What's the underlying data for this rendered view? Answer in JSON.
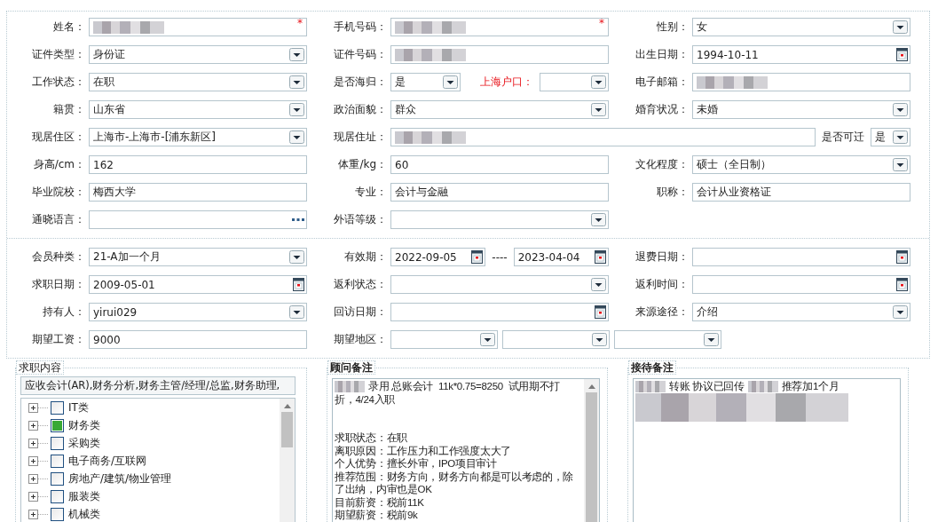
{
  "form_sections": [
    {
      "rows": [
        {
          "cells": [
            {
              "items": [
                {
                  "label": "姓名：",
                  "kind": "text",
                  "redacted": true,
                  "required_mark": "*"
                }
              ]
            },
            {
              "items": [
                {
                  "label": "手机号码：",
                  "kind": "text",
                  "redacted": true,
                  "required_mark": "*"
                }
              ]
            },
            {
              "items": [
                {
                  "label": "性别：",
                  "kind": "select",
                  "value": "女"
                }
              ]
            }
          ]
        },
        {
          "cells": [
            {
              "items": [
                {
                  "label": "证件类型：",
                  "kind": "select",
                  "value": "身份证"
                }
              ]
            },
            {
              "items": [
                {
                  "label": "证件号码：",
                  "kind": "text",
                  "redacted": true
                }
              ]
            },
            {
              "items": [
                {
                  "label": "出生日期：",
                  "kind": "date",
                  "value": "1994-10-11"
                }
              ]
            }
          ]
        },
        {
          "cells": [
            {
              "items": [
                {
                  "label": "工作状态：",
                  "kind": "select",
                  "value": "在职"
                }
              ]
            },
            {
              "items": [
                {
                  "label": "是否海归：",
                  "kind": "select",
                  "value": "是"
                },
                {
                  "label": "上海户口：",
                  "kind": "select",
                  "highlight": true
                }
              ]
            },
            {
              "items": [
                {
                  "label": "电子邮箱：",
                  "kind": "text",
                  "redacted": true
                }
              ]
            }
          ]
        },
        {
          "cells": [
            {
              "items": [
                {
                  "label": "籍贯：",
                  "kind": "select",
                  "value": "山东省"
                }
              ]
            },
            {
              "items": [
                {
                  "label": "政治面貌：",
                  "kind": "select",
                  "value": "群众"
                }
              ]
            },
            {
              "items": [
                {
                  "label": "婚育状况：",
                  "kind": "select",
                  "value": "未婚"
                }
              ]
            }
          ]
        },
        {
          "cells": [
            {
              "items": [
                {
                  "label": "现居住区：",
                  "kind": "select",
                  "value": "上海市-上海市-[浦东新区]"
                }
              ]
            },
            {
              "items": [
                {
                  "label": "现居住址：",
                  "kind": "text",
                  "redacted": true
                },
                {
                  "label": "是否可迁",
                  "kind": "select",
                  "value": "是"
                }
              ]
            }
          ]
        },
        {
          "cells": [
            {
              "items": [
                {
                  "label": "身高/cm：",
                  "kind": "text",
                  "value": "162"
                }
              ]
            },
            {
              "items": [
                {
                  "label": "体重/kg：",
                  "kind": "text",
                  "value": "60"
                }
              ]
            },
            {
              "items": [
                {
                  "label": "文化程度：",
                  "kind": "select",
                  "value": "硕士（全日制）"
                }
              ]
            }
          ]
        },
        {
          "cells": [
            {
              "items": [
                {
                  "label": "毕业院校：",
                  "kind": "text",
                  "value": "梅西大学"
                }
              ]
            },
            {
              "items": [
                {
                  "label": "专业：",
                  "kind": "text",
                  "value": "会计与金融"
                }
              ]
            },
            {
              "items": [
                {
                  "label": "职称：",
                  "kind": "text",
                  "value": "会计从业资格证"
                }
              ]
            }
          ]
        },
        {
          "cells": [
            {
              "items": [
                {
                  "label": "通晓语言：",
                  "kind": "lookup"
                }
              ]
            },
            {
              "items": [
                {
                  "label": "外语等级：",
                  "kind": "select"
                }
              ]
            }
          ]
        }
      ]
    },
    {
      "rows": [
        {
          "cells": [
            {
              "items": [
                {
                  "label": "会员种类：",
                  "kind": "select",
                  "value": "21-A加一个月"
                }
              ]
            },
            {
              "items": [
                {
                  "label": "有效期：",
                  "kind": "date",
                  "value": "2022-09-05"
                },
                {
                  "prefix": "----",
                  "kind": "date",
                  "value": "2023-04-04"
                }
              ]
            },
            {
              "items": [
                {
                  "label": "退费日期：",
                  "kind": "date"
                }
              ]
            }
          ]
        },
        {
          "cells": [
            {
              "items": [
                {
                  "label": "求职日期：",
                  "kind": "date",
                  "value": "2009-05-01"
                }
              ]
            },
            {
              "items": [
                {
                  "label": "返利状态：",
                  "kind": "select"
                }
              ]
            },
            {
              "items": [
                {
                  "label": "返利时间：",
                  "kind": "date"
                }
              ]
            }
          ]
        },
        {
          "cells": [
            {
              "items": [
                {
                  "label": "持有人：",
                  "kind": "select",
                  "value": "yirui029"
                }
              ]
            },
            {
              "items": [
                {
                  "label": "回访日期：",
                  "kind": "date"
                }
              ]
            },
            {
              "items": [
                {
                  "label": "来源途径：",
                  "kind": "select",
                  "value": "介绍"
                }
              ]
            }
          ]
        },
        {
          "cells": [
            {
              "items": [
                {
                  "label": "期望工资：",
                  "kind": "text",
                  "value": "9000"
                }
              ]
            },
            {
              "items": [
                {
                  "label": "期望地区：",
                  "kind": "select"
                },
                {
                  "kind": "select"
                },
                {
                  "kind": "select"
                }
              ]
            }
          ]
        }
      ]
    }
  ],
  "job_content": {
    "legend": "求职内容",
    "bold": false,
    "selection": "应收会计(AR),财务分析,财务主管/经理/总监,财务助理,",
    "categories": [
      {
        "label": "IT类",
        "checked": false
      },
      {
        "label": "财务类",
        "checked": true
      },
      {
        "label": "采购类",
        "checked": false
      },
      {
        "label": "电子商务/互联网",
        "checked": false
      },
      {
        "label": "房地产/建筑/物业管理",
        "checked": false
      },
      {
        "label": "服装类",
        "checked": false
      },
      {
        "label": "机械类",
        "checked": false
      }
    ]
  },
  "notes": [
    {
      "legend": "顾问备注",
      "bold": true,
      "lines": [
        {
          "kind": "text",
          "segments": [
            {
              "kind": "redacted"
            },
            {
              "kind": "text",
              "text": "录用 总账会计  11k*0.75=8250  试用期不打"
            }
          ]
        },
        {
          "kind": "text",
          "segments": [
            {
              "kind": "text",
              "text": "折，4/24入职"
            }
          ]
        },
        {
          "kind": "blank"
        },
        {
          "kind": "blank"
        },
        {
          "kind": "text",
          "segments": [
            {
              "kind": "text",
              "text": "求职状态：在职"
            }
          ]
        },
        {
          "kind": "text",
          "segments": [
            {
              "kind": "text",
              "text": "离职原因：工作压力和工作强度太大了"
            }
          ]
        },
        {
          "kind": "text",
          "segments": [
            {
              "kind": "text",
              "text": "个人优势：擅长外审，IPO项目审计"
            }
          ]
        },
        {
          "kind": "text",
          "segments": [
            {
              "kind": "text",
              "text": "推荐范围：财务方向，财务方向都是可以考虑的，除"
            }
          ]
        },
        {
          "kind": "text",
          "segments": [
            {
              "kind": "text",
              "text": "了出纳，内审也是OK"
            }
          ]
        },
        {
          "kind": "text",
          "segments": [
            {
              "kind": "text",
              "text": "目前薪资：税前11K"
            }
          ]
        },
        {
          "kind": "text",
          "segments": [
            {
              "kind": "text",
              "text": "期望薪资：税前9k"
            }
          ]
        }
      ]
    },
    {
      "legend": "接待备注",
      "bold": true,
      "lines": [
        {
          "kind": "text",
          "segments": [
            {
              "kind": "redacted"
            },
            {
              "kind": "text",
              "text": "转账 协议已回传"
            },
            {
              "kind": "redacted"
            },
            {
              "kind": "text",
              "text": "推荐加1个月"
            }
          ]
        },
        {
          "kind": "text",
          "segments": [
            {
              "kind": "redacted"
            }
          ]
        },
        {
          "kind": "text",
          "segments": [
            {
              "kind": "redacted"
            }
          ]
        }
      ]
    }
  ]
}
